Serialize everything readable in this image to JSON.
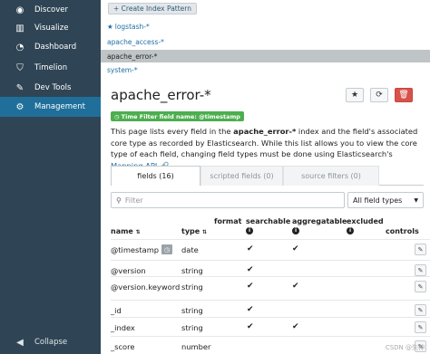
{
  "sidebar": {
    "items": [
      {
        "label": "Discover",
        "icon": "compass-icon"
      },
      {
        "label": "Visualize",
        "icon": "bar-chart-icon"
      },
      {
        "label": "Dashboard",
        "icon": "dashboard-icon"
      },
      {
        "label": "Timelion",
        "icon": "shield-icon"
      },
      {
        "label": "Dev Tools",
        "icon": "wrench-icon"
      },
      {
        "label": "Management",
        "icon": "gear-icon",
        "active": true
      }
    ],
    "collapse_label": "Collapse"
  },
  "index_patterns": {
    "create_button": "+ Create Index Pattern",
    "items": [
      "logstash-*",
      "apache_access-*",
      "apache_error-*",
      "system-*"
    ],
    "default": "logstash-*",
    "selected": "apache_error-*"
  },
  "detail": {
    "title": "apache_error-*",
    "time_filter_badge": "Time Filter field name: @timestamp",
    "description_before": "This page lists every field in the ",
    "description_index": "apache_error-*",
    "description_after": " index and the field's associated core type as recorded by Elasticsearch. While this list allows you to view the core type of each field, changing field types must be done using Elasticsearch's ",
    "description_link": "Mapping API"
  },
  "tabs": [
    {
      "label": "fields (16)",
      "active": true
    },
    {
      "label": "scripted fields (0)",
      "active": false
    },
    {
      "label": "source filters (0)",
      "active": false
    }
  ],
  "filter": {
    "placeholder": "Filter",
    "type_select": "All field types"
  },
  "table": {
    "headers": {
      "name": "name",
      "type": "type",
      "format": "format",
      "searchable": "searchable",
      "aggregatable": "aggregatable",
      "excluded": "excluded",
      "controls": "controls"
    },
    "rows": [
      {
        "name": "@timestamp",
        "type": "date",
        "searchable": true,
        "aggregatable": true,
        "time_field": true
      },
      {
        "name": "@version",
        "type": "string",
        "searchable": true,
        "aggregatable": false
      },
      {
        "name": "@version.keyword",
        "type": "string",
        "searchable": true,
        "aggregatable": true
      },
      {
        "name": "_id",
        "type": "string",
        "searchable": true,
        "aggregatable": false
      },
      {
        "name": "_index",
        "type": "string",
        "searchable": true,
        "aggregatable": true
      },
      {
        "name": "_score",
        "type": "number",
        "searchable": false,
        "aggregatable": false
      }
    ]
  },
  "watermark": "CSDN @失神"
}
